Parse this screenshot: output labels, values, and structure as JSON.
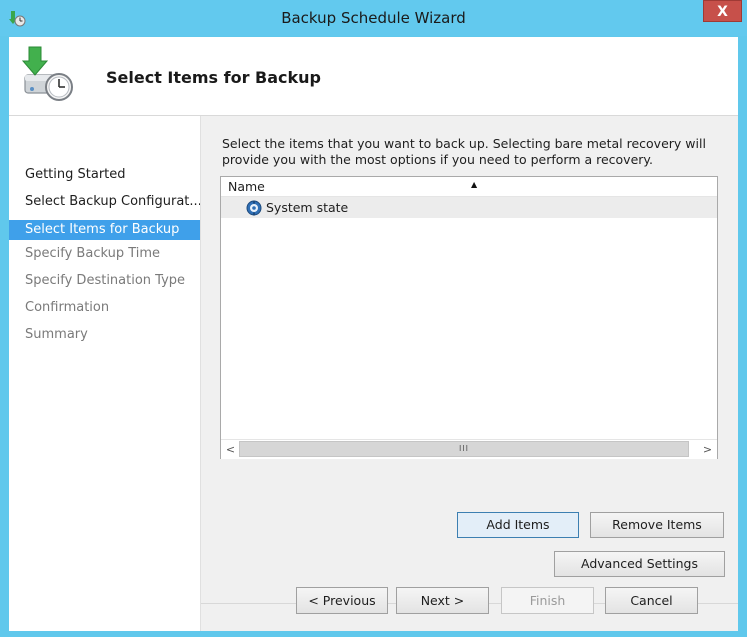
{
  "window": {
    "title": "Backup Schedule Wizard",
    "close_label": "X"
  },
  "header": {
    "title": "Select Items for Backup"
  },
  "steps": [
    {
      "label": "Getting Started",
      "state": "done"
    },
    {
      "label": "Select Backup Configurat...",
      "state": "done"
    },
    {
      "label": "Select Items for Backup",
      "state": "current"
    },
    {
      "label": "Specify Backup Time",
      "state": "future"
    },
    {
      "label": "Specify Destination Type",
      "state": "future"
    },
    {
      "label": "Confirmation",
      "state": "future"
    },
    {
      "label": "Summary",
      "state": "future"
    }
  ],
  "content": {
    "instructions": "Select the items that you want to back up. Selecting bare metal recovery will provide you with the most options if you need to perform a recovery.",
    "list": {
      "column_name": "Name",
      "items": [
        {
          "label": "System state",
          "icon": "system-state-icon"
        }
      ],
      "scroll_left": "<",
      "scroll_right": ">",
      "scroll_grip": "III"
    },
    "buttons": {
      "add_items": "Add Items",
      "remove_items": "Remove Items",
      "advanced_settings": "Advanced Settings"
    }
  },
  "footer": {
    "previous": "< Previous",
    "next": "Next >",
    "finish": "Finish",
    "cancel": "Cancel"
  },
  "colors": {
    "titlebar": "#62c9ee",
    "selection": "#3fa0ea",
    "close": "#c7504a"
  }
}
